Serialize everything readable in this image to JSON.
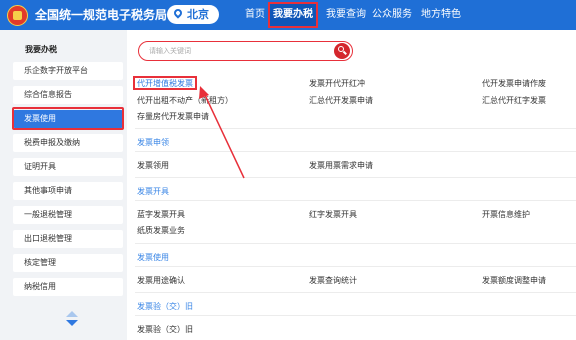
{
  "header": {
    "title": "全国统一规范电子税务局",
    "city": "北京",
    "nav": [
      "首页",
      "我要办税",
      "我要查询",
      "公众服务",
      "地方特色"
    ]
  },
  "sidebar": {
    "title": "我要办税",
    "items": [
      "乐企数字开放平台",
      "综合信息报告",
      "发票使用",
      "税费申报及缴纳",
      "证明开具",
      "其他事项申请",
      "一般退税管理",
      "出口退税管理",
      "核定管理",
      "纳税信用"
    ],
    "active_index": 2
  },
  "search": {
    "placeholder": "请输入关键词"
  },
  "sections": {
    "top_links": [
      "代开增值税发票",
      "发票开代开红冲",
      "代开发票申请作废",
      "代开出租不动产（新租方）",
      "汇总代开发票申请",
      "汇总代开红字发票",
      "存量房代开发票申请"
    ],
    "invoice_receive": {
      "title": "发票申领",
      "links": [
        "发票领用",
        "发票用票需求申请"
      ]
    },
    "invoice_issue": {
      "title": "发票开具",
      "links": [
        "蓝字发票开具",
        "红字发票开具",
        "开票信息维护",
        "纸质发票业务"
      ]
    },
    "invoice_use": {
      "title": "发票使用",
      "links": [
        "发票用途确认",
        "发票查询统计",
        "发票额度调整申请"
      ]
    },
    "invoice_verify": {
      "title": "发票验（交）旧",
      "links": [
        "发票验（交）旧"
      ]
    }
  },
  "colors": {
    "header": "#1f6fd6",
    "accent": "#2f78e0",
    "highlight": "#e8303a"
  }
}
